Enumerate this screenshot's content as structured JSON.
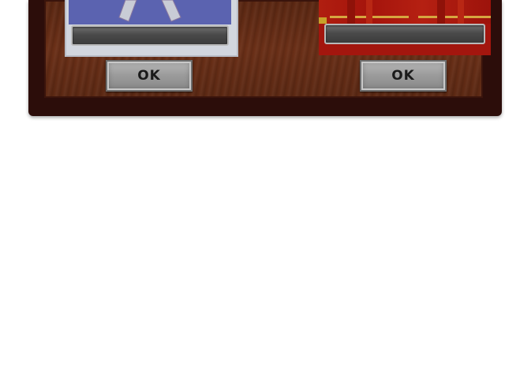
{
  "dialog": {
    "left_option": {
      "name_value": "",
      "ok_label": "OK",
      "art_color": "#5b63b0"
    },
    "right_option": {
      "name_value": "",
      "ok_label": "OK",
      "art_color": "#a3160e"
    }
  },
  "icons": [
    "ribbon-icon",
    "curtain-icon"
  ]
}
